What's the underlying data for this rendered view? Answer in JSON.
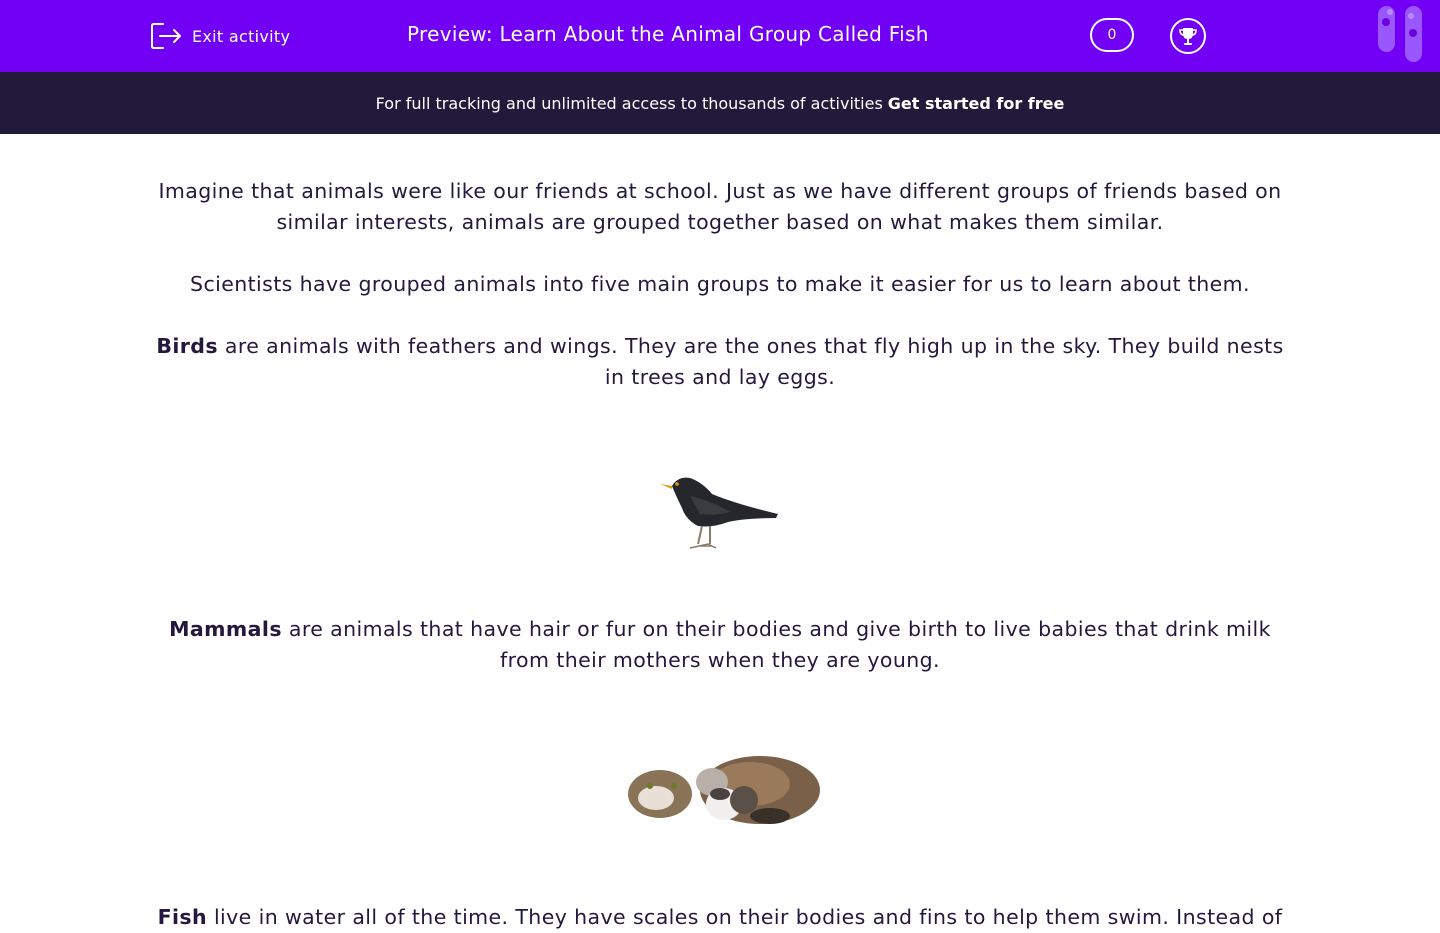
{
  "header": {
    "exit_label": "Exit activity",
    "title": "Preview: Learn About the Animal Group Called Fish",
    "score": "0",
    "background_color": "#7200f5"
  },
  "banner": {
    "text": "For full tracking and unlimited access to thousands of activities",
    "link": "Get started for free",
    "background_color": "#221a3a"
  },
  "content": {
    "intro": "Imagine that animals were like our friends at school. Just as we have different groups of friends based on similar interests, animals are grouped together based on what makes them similar.",
    "groups_intro": "Scientists have grouped animals into five main groups to make it easier for us to learn about them.",
    "birds": {
      "term": "Birds",
      "text": " are animals with feathers and wings.  They are the ones that fly high up in the sky. They build nests in trees and lay eggs."
    },
    "mammals": {
      "term": "Mammals",
      "text": " are animals that have hair or fur on their bodies and give birth to live babies that drink milk from their mothers when they are young."
    },
    "fish": {
      "term": "Fish",
      "text": " live in water all of the time.  They have scales on their bodies and fins to help them swim. Instead of"
    }
  }
}
